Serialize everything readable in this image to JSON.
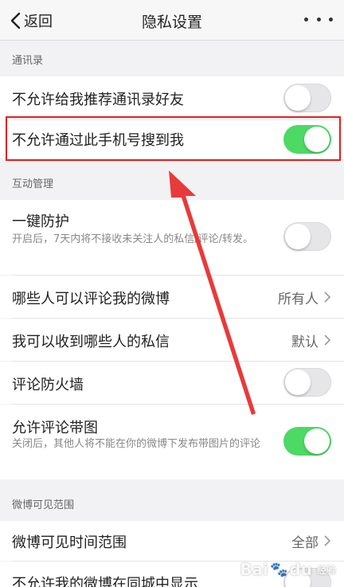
{
  "header": {
    "back_label": "返回",
    "title": "隐私设置"
  },
  "sections": {
    "contacts": "通讯录",
    "interaction": "互动管理",
    "visibility": "微博可见范围"
  },
  "rows": {
    "recommend_contacts": {
      "label": "不允许给我推荐通讯录好友",
      "toggle": false
    },
    "search_by_phone": {
      "label": "不允许通过此手机号搜到我",
      "toggle": true
    },
    "one_click_protect": {
      "label": "一键防护",
      "sublabel": "开启后，7天内将不接收未关注人的私信/评论/转发。",
      "toggle": false
    },
    "who_can_comment": {
      "label": "哪些人可以评论我的微博",
      "value": "所有人"
    },
    "who_can_message": {
      "label": "我可以收到哪些人的私信",
      "value": "默认"
    },
    "comment_firewall": {
      "label": "评论防火墙",
      "toggle": false
    },
    "allow_comment_images": {
      "label": "允许评论带图",
      "sublabel": "关闭后，其他人将不能在你的微博下发布带图片的评论",
      "toggle": true
    },
    "visible_time_range": {
      "label": "微博可见时间范围",
      "value": "全部"
    },
    "hide_in_local": {
      "label": "不允许我的微博在同城中显示",
      "toggle": false
    }
  },
  "watermark": {
    "text": "Bai",
    "suffix": "du",
    "tail": "经验"
  },
  "colors": {
    "toggle_on": "#4cd964",
    "toggle_off": "#e6e6e8",
    "annotation_red": "#e02020"
  }
}
